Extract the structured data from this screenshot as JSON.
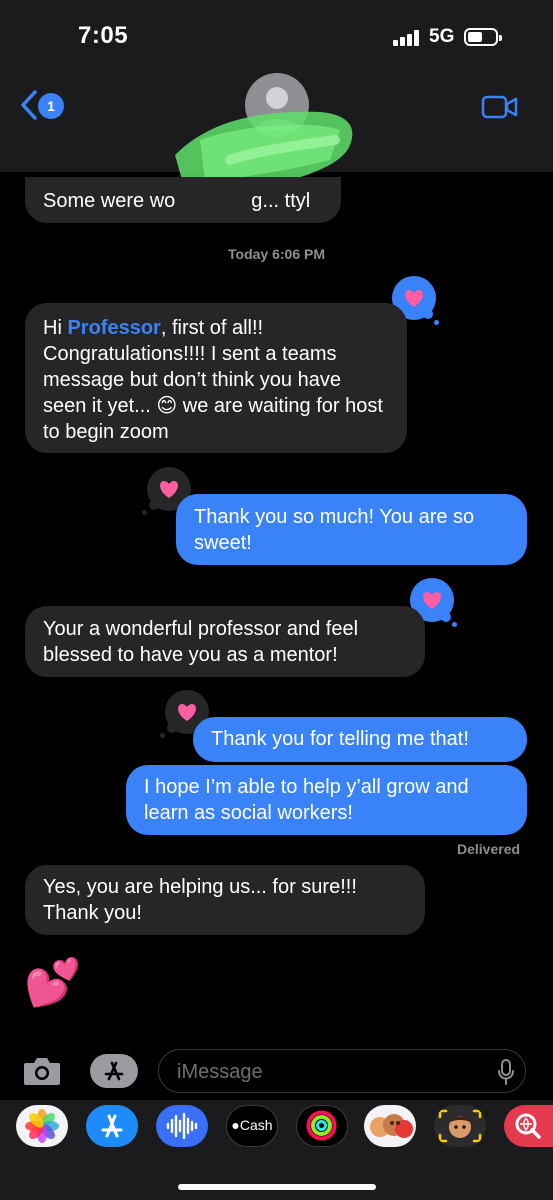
{
  "status": {
    "time": "7:05",
    "network": "5G"
  },
  "header": {
    "unread_count": "1"
  },
  "messages": {
    "partial": "Some were wo",
    "partial_end": "g... ttyl",
    "timestamp": "Today 6:06 PM",
    "m1_pre": "Hi ",
    "m1_name": "Professor",
    "m1_post": ", first of all!! Congratulations!!!!  I sent a teams message but don’t think you have seen it yet... 😊 we are waiting for host to begin zoom",
    "m2": "Thank you so much! You are so sweet!",
    "m3": "Your a wonderful professor and feel blessed to have you as a mentor!",
    "m4": "Thank you for telling me that!",
    "m5": "I hope I’m able to help y’all grow and learn as social workers!",
    "delivered": "Delivered",
    "m6": "Yes, you are helping us... for sure!!! Thank you!",
    "m7": "💕"
  },
  "composer": {
    "placeholder": "iMessage"
  },
  "apps": {
    "cash_label": "Cash"
  },
  "colors": {
    "accent": "#3a82f7",
    "incoming": "#262628",
    "heart": "#ff5fa2"
  }
}
